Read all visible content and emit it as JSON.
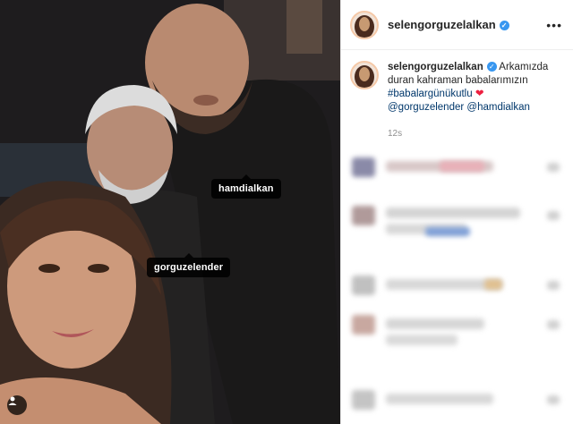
{
  "post": {
    "username": "selengorguzelalkan",
    "caption_lines": [
      "Arkamızda",
      "duran kahraman babalarımızın"
    ],
    "hashtag": "#babalargünükutlu",
    "mentions": [
      "@gorguzelender",
      "@hamdialkan"
    ],
    "timestamp": "12s"
  },
  "photo": {
    "tags": [
      "hamdialkan",
      "gorguzelender"
    ]
  },
  "colors": {
    "verified": "#3897f0",
    "link": "#00376b",
    "heart": "#ed2040"
  }
}
